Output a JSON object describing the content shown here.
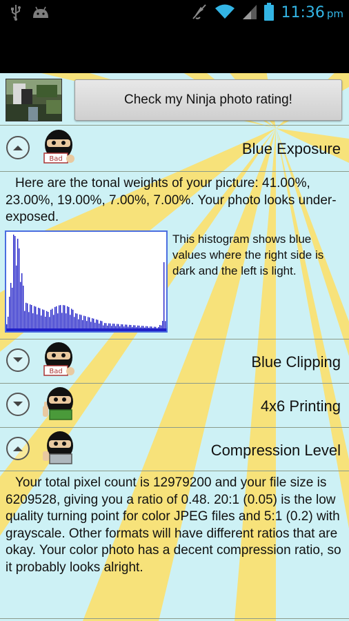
{
  "status_bar": {
    "left_icons": [
      "usb-icon",
      "android-icon"
    ],
    "right_icons": [
      "mute-icon",
      "wifi-icon",
      "signal-icon",
      "battery-icon"
    ],
    "time": "11:36",
    "ampm": "pm"
  },
  "top": {
    "check_button_label": "Check my Ninja photo rating!"
  },
  "sections": {
    "blue_exposure": {
      "title": "Blue Exposure",
      "expanded": true,
      "body": "Here are the tonal weights of your picture: 41.00%, 23.00%, 19.00%, 7.00%, 7.00%.  Your photo looks under-exposed.",
      "histogram_note": "This histogram shows blue values where the right side is dark and the left is light."
    },
    "blue_clipping": {
      "title": "Blue Clipping",
      "expanded": false
    },
    "printing": {
      "title": "4x6 Printing",
      "expanded": false
    },
    "compression": {
      "title": "Compression Level",
      "expanded": true,
      "body": "Your total pixel count is 12979200 and your file size is 6209528, giving you a ratio of 0.48.  20:1 (0.05) is the low quality turning point for color JPEG files and 5:1 (0.2) with grayscale.  Other formats will have different ratios that are okay.  Your color photo has a decent compression ratio, so it probably looks alright."
    }
  },
  "colors": {
    "accent": "#33b5e5",
    "background": "#cdf1f5",
    "rays": "#f7e27a",
    "histogram_bar": "#2020c8"
  }
}
